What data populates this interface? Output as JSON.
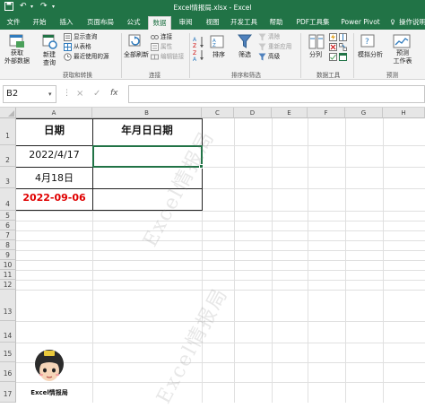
{
  "window": {
    "title": "Excel情报局.xlsx - Excel"
  },
  "tabs": [
    {
      "label": "文件",
      "active": false
    },
    {
      "label": "开始",
      "active": false
    },
    {
      "label": "插入",
      "active": false
    },
    {
      "label": "页面布局",
      "active": false
    },
    {
      "label": "公式",
      "active": false
    },
    {
      "label": "数据",
      "active": true
    },
    {
      "label": "审阅",
      "active": false
    },
    {
      "label": "视图",
      "active": false
    },
    {
      "label": "开发工具",
      "active": false
    },
    {
      "label": "帮助",
      "active": false
    },
    {
      "label": "PDF工具集",
      "active": false
    },
    {
      "label": "Power Pivot",
      "active": false
    },
    {
      "label": "操作说明搜",
      "active": false
    }
  ],
  "ribbon": {
    "get_data": "获取",
    "get_data2": "外部数据",
    "new_query": "新建",
    "new_query2": "查询",
    "show_query": "显示查询",
    "from_table": "从表格",
    "recent_sources": "最近使用的源",
    "group_get_transform": "获取和转换",
    "refresh_all": "全部刷新",
    "connections": "连接",
    "properties": "属性",
    "edit_links": "编辑链接",
    "group_connections": "连接",
    "sort": "排序",
    "filter": "筛选",
    "clear": "清除",
    "reapply": "重新应用",
    "advanced": "高级",
    "group_sort_filter": "排序和筛选",
    "text_to_columns": "分列",
    "group_data_tools": "数据工具",
    "what_if": "模拟分析",
    "forecast_sheet": "预测",
    "forecast_sheet2": "工作表",
    "group_forecast": "预测"
  },
  "formula_bar": {
    "name_box": "B2",
    "cancel": "×",
    "enter": "✓",
    "fx": "fx",
    "content": ""
  },
  "columns": [
    "A",
    "B",
    "C",
    "D",
    "E",
    "F",
    "G",
    "H"
  ],
  "rows": [
    "1",
    "2",
    "3",
    "4",
    "5",
    "6",
    "7",
    "8",
    "9",
    "10",
    "11",
    "12",
    "13",
    "14",
    "15",
    "16",
    "17"
  ],
  "cells": {
    "A1": "日期",
    "B1": "年月日日期",
    "A2": "2022/4/17",
    "A3": "4月18日",
    "A4": "2022-09-06"
  },
  "colors": {
    "excel_green": "#217346",
    "red_text": "#e00000"
  },
  "watermark": "Excel情报局",
  "logo": {
    "caption": "Excel情报局"
  }
}
